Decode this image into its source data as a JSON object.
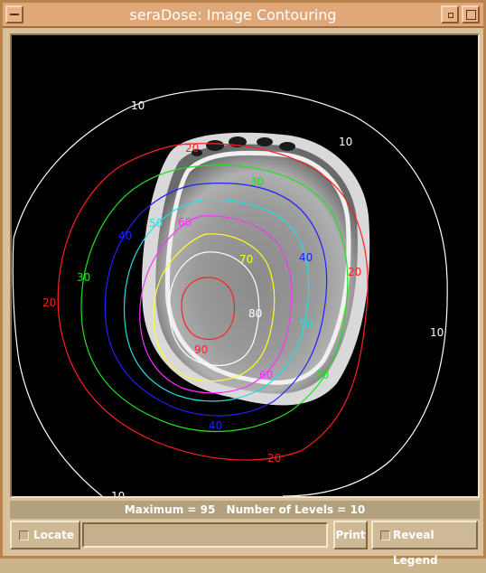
{
  "window": {
    "title": "seraDose:  Image Contouring"
  },
  "status": {
    "maximum": "Maximum = 95",
    "levels": "Number of Levels = 10"
  },
  "buttons": {
    "locate": "Locate",
    "print": "Print",
    "reveal_legend": "Reveal Legend"
  },
  "colors": {
    "c10": "#ffffff",
    "c20": "#ff2020",
    "c30": "#20e020",
    "c40": "#2020ff",
    "c50": "#20e0e0",
    "c60": "#ff30ff",
    "c70": "#ffff20",
    "c80": "#ffffff",
    "c90": "#ff2020"
  },
  "contour_labels": {
    "l10a": "10",
    "l10b": "10",
    "l10c": "10",
    "l10d": "10",
    "l20a": "20",
    "l20b": "20",
    "l20c": "20",
    "l20d": "20",
    "l30a": "30",
    "l30b": "30",
    "l30c": "30",
    "l40a": "40",
    "l40b": "40",
    "l40c": "40",
    "l50a": "50",
    "l50b": "50",
    "l60a": "60",
    "l60b": "60",
    "l70a": "70",
    "l80a": "80",
    "l90a": "90"
  }
}
